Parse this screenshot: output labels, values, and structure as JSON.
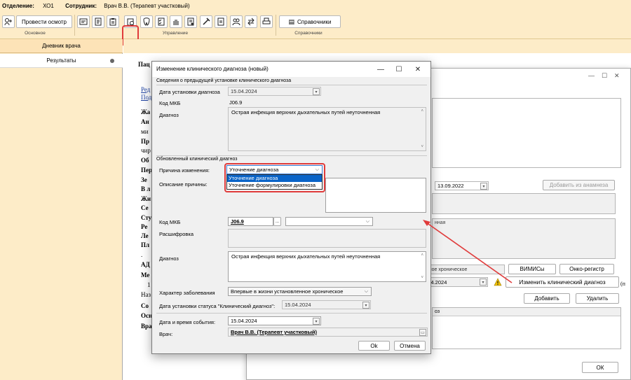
{
  "infobar": {
    "dept_label": "Отделение:",
    "dept_value": "ХО1",
    "staff_label": "Сотрудник:",
    "staff_value": "Врач В.В. (Терапевт участковый)"
  },
  "ribbon": {
    "exam_button": "Провести осмотр",
    "group_basic": "Основное",
    "group_manage": "Управление",
    "reference_button": "Справочники",
    "group_reference": "Справочники"
  },
  "left_panel": {
    "header": "Дневник врача",
    "item": "Результаты"
  },
  "document": {
    "patient_prefix": "Пац",
    "link1": "Ред",
    "link2": "Под",
    "lines": [
      "Жа",
      "Ан",
      "ми",
      "Пр",
      "чир",
      "Об",
      "Пер",
      "Зе",
      "В л",
      "Жи",
      "Се",
      "Сту",
      "Ре",
      "Ле",
      "Пл",
      ".",
      "АД",
      "Ме",
      "1",
      "Наз",
      "Со",
      "Осн",
      "Вра"
    ]
  },
  "bg_window": {
    "date_value": "13.09.2022",
    "add_from_anamnesis": "Добавить из анамнеза",
    "unrefined_text": "нная",
    "chronic_text": "енное хроническое",
    "vimis_button": "ВИМИСы",
    "onco_button": "Онко-регистр",
    "date2_value": "5.04.2024",
    "change_diagnosis_button": "Изменить клинический диагноз",
    "add_button": "Добавить",
    "delete_button": "Удалить",
    "table_header": "оз",
    "ok_button": "ОК",
    "side_text": "(п"
  },
  "dialog": {
    "title": "Изменение клинического диагноза (новый)",
    "prev_section": "Сведения о предыдущей установке клинического диагноза",
    "date_label": "Дата установки диагноза",
    "date_value": "15.04.2024",
    "mkb_label": "Код МКБ",
    "mkb_value": "J06.9",
    "diagnosis_label": "Диагноз",
    "diagnosis_value": "Острая инфекция верхних дыхательных путей неуточненная",
    "updated_section": "Обновленный клинический диагноз",
    "reason_label": "Причина изменения:",
    "reason_value": "Уточнение диагноза",
    "reason_options": [
      "Уточнение диагноза",
      "Уточнение формулировки диагноза"
    ],
    "desc_label": "Описание причины:",
    "new_mkb_label": "Код МКБ",
    "new_mkb_value": "J06.9",
    "decode_label": "Расшифровка",
    "new_diag_label": "Диагноз",
    "new_diag_value": "Острая инфекция верхних дыхательных путей неуточненная",
    "character_label": "Характер заболевания",
    "character_value": "Впервые в жизни установленное хроническое",
    "status_date_label": "Дата установки статуса \"Клинический диагноз\":",
    "status_date_value": "15.04.2024",
    "event_label": "Дата и время события:",
    "event_value": "15.04.2024",
    "doctor_label": "Врач:",
    "doctor_value": "Врач В.В. (Терапевт участковый)",
    "ok_button": "Ok",
    "cancel_button": "Отмена"
  },
  "colors": {
    "ribbon_bg": "#fdecc8",
    "highlight": "#e03b3b",
    "selection": "#0a64c8"
  }
}
